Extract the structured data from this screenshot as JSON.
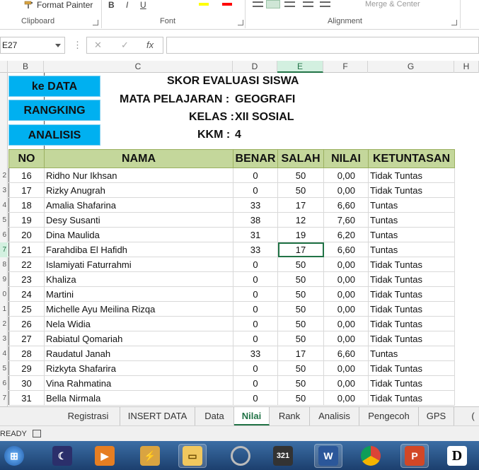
{
  "ribbon": {
    "format_painter": "Format Painter",
    "clipboard": "Clipboard",
    "font": "Font",
    "alignment": "Alignment",
    "merge": "Merge & Center",
    "bold": "B",
    "italic": "I",
    "underline": "U"
  },
  "formula": {
    "namebox": "E27",
    "fx": "fx",
    "cancel": "✕",
    "enter": "✓",
    "value": ""
  },
  "columns": [
    "B",
    "C",
    "D",
    "E",
    "F",
    "G",
    "H"
  ],
  "rows": [
    "2",
    "3",
    "4",
    "5",
    "6",
    "7",
    "8",
    "9",
    "0",
    "1",
    "2",
    "3",
    "4",
    "5",
    "6",
    "7"
  ],
  "buttons": {
    "data": "ke DATA",
    "rank": "RANGKING",
    "analysis": "ANALISIS"
  },
  "header": {
    "title": "SKOR EVALUASI SISWA",
    "subject_label": "MATA PELAJARAN :",
    "subject_value": "GEOGRAFI",
    "class_label": "KELAS :",
    "class_value": "XII SOSIAL",
    "kkm_label": "KKM :",
    "kkm_value": "4"
  },
  "table": {
    "headers": [
      "NO",
      "NAMA",
      "BENAR",
      "SALAH",
      "NILAI",
      "KETUNTASAN"
    ],
    "rows": [
      [
        "16",
        "Ridho Nur Ikhsan",
        "0",
        "50",
        "0,00",
        "Tidak Tuntas"
      ],
      [
        "17",
        "Rizky Anugrah",
        "0",
        "50",
        "0,00",
        "Tidak Tuntas"
      ],
      [
        "18",
        "Amalia Shafarina",
        "33",
        "17",
        "6,60",
        "Tuntas"
      ],
      [
        "19",
        "Desy Susanti",
        "38",
        "12",
        "7,60",
        "Tuntas"
      ],
      [
        "20",
        "Dina Maulida",
        "31",
        "19",
        "6,20",
        "Tuntas"
      ],
      [
        "21",
        "Farahdiba El Hafidh",
        "33",
        "17",
        "6,60",
        "Tuntas"
      ],
      [
        "22",
        "Islamiyati Faturrahmi",
        "0",
        "50",
        "0,00",
        "Tidak Tuntas"
      ],
      [
        "23",
        "Khaliza",
        "0",
        "50",
        "0,00",
        "Tidak Tuntas"
      ],
      [
        "24",
        "Martini",
        "0",
        "50",
        "0,00",
        "Tidak Tuntas"
      ],
      [
        "25",
        "Michelle Ayu Meilina Rizqa",
        "0",
        "50",
        "0,00",
        "Tidak Tuntas"
      ],
      [
        "26",
        "Nela Widia",
        "0",
        "50",
        "0,00",
        "Tidak Tuntas"
      ],
      [
        "27",
        "Rabiatul Qomariah",
        "0",
        "50",
        "0,00",
        "Tidak Tuntas"
      ],
      [
        "28",
        "Raudatul Janah",
        "33",
        "17",
        "6,60",
        "Tuntas"
      ],
      [
        "29",
        "Rizkyta Shafarira",
        "0",
        "50",
        "0,00",
        "Tidak Tuntas"
      ],
      [
        "30",
        "Vina Rahmatina",
        "0",
        "50",
        "0,00",
        "Tidak Tuntas"
      ],
      [
        "31",
        "Bella Nirmala",
        "0",
        "50",
        "0,00",
        "Tidak Tuntas"
      ]
    ]
  },
  "sheet_tabs": [
    "Registrasi",
    "INSERT DATA",
    "Data",
    "Nilai",
    "Rank",
    "Analisis",
    "Pengecoh",
    "GPS"
  ],
  "active_tab": "Nilai",
  "status": {
    "ready": "READY"
  },
  "colors": {
    "accent": "#217346",
    "button": "#00b0f0",
    "table_header": "#c4d79b"
  }
}
